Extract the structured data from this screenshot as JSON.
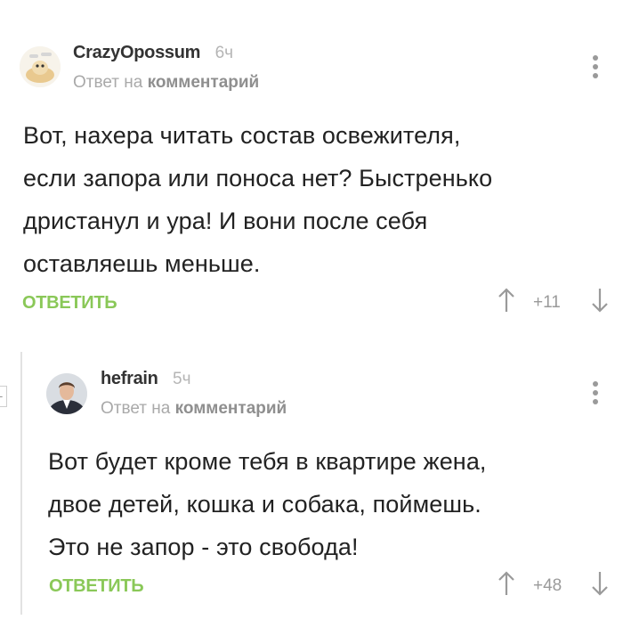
{
  "comments": [
    {
      "username": "CrazyOpossum",
      "time": "6ч",
      "reply_prefix": "Ответ на",
      "reply_link": "комментарий",
      "lines": [
        "Вот, нахера читать состав освежителя,",
        "если запора или поноса нет? Быстренько",
        "дристанул и ура! И вони после себя",
        "оставляешь меньше."
      ],
      "reply_button": "ОТВЕТИТЬ",
      "rating": "+11"
    },
    {
      "username": "hefrain",
      "time": "5ч",
      "reply_prefix": "Ответ на",
      "reply_link": "комментарий",
      "lines": [
        "Вот будет кроме тебя в квартире жена,",
        "двое детей, кошка и собака, поймешь.",
        "Это не запор - это свобода!"
      ],
      "reply_button": "ОТВЕТИТЬ",
      "rating": "+48"
    }
  ],
  "thread": {
    "collapse_symbol": "-"
  },
  "icons": {
    "upvote": "arrow-up-icon",
    "downvote": "arrow-down-icon",
    "menu": "more-vertical-icon"
  },
  "colors": {
    "accent_green": "#8ac858",
    "muted_text": "#a9a9a9",
    "body_text": "#222222"
  }
}
